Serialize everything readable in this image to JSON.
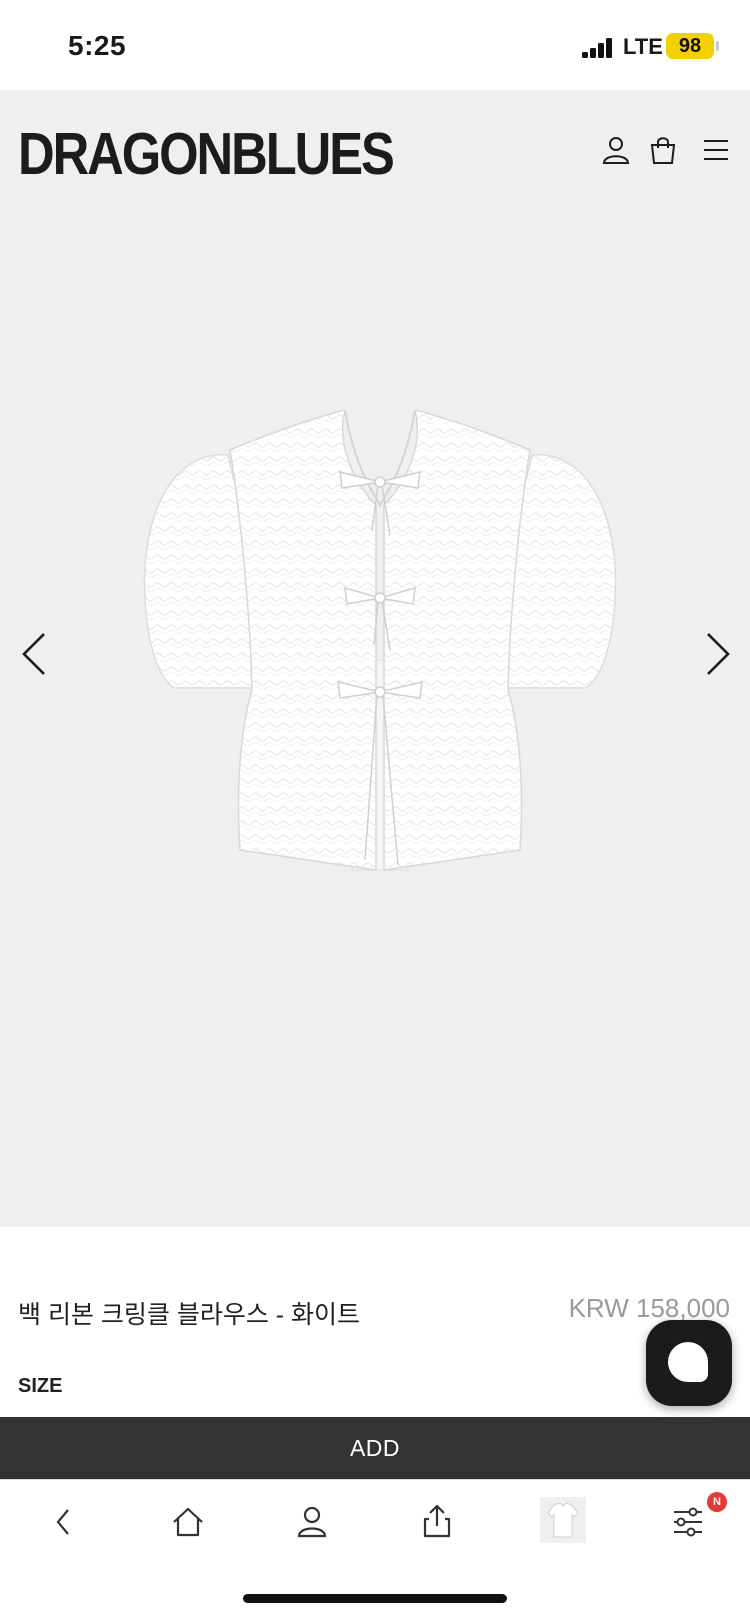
{
  "status_bar": {
    "time": "5:25",
    "network": "LTE",
    "battery": "98",
    "battery_color": "#f5d000"
  },
  "header": {
    "logo": "DRAGONBLUES",
    "icons": [
      "user-icon",
      "shopping-bag-icon",
      "menu-icon"
    ]
  },
  "gallery": {
    "background": "#efefef",
    "prev_icon": "chevron-left-icon",
    "next_icon": "chevron-right-icon",
    "image": "white-ribbon-blouse"
  },
  "product": {
    "name": "백 리본 크링클 블라우스 - 화이트",
    "price": "KRW 158,000",
    "size_label": "SIZE"
  },
  "actions": {
    "add_label": "ADD",
    "add_bg": "#333333"
  },
  "chat": {
    "icon": "chat-bubble-icon"
  },
  "bottom_nav": {
    "items": [
      "back-icon",
      "home-icon",
      "profile-icon",
      "share-icon",
      "product-thumbnail",
      "settings-icon"
    ],
    "notification_badge": "N"
  }
}
